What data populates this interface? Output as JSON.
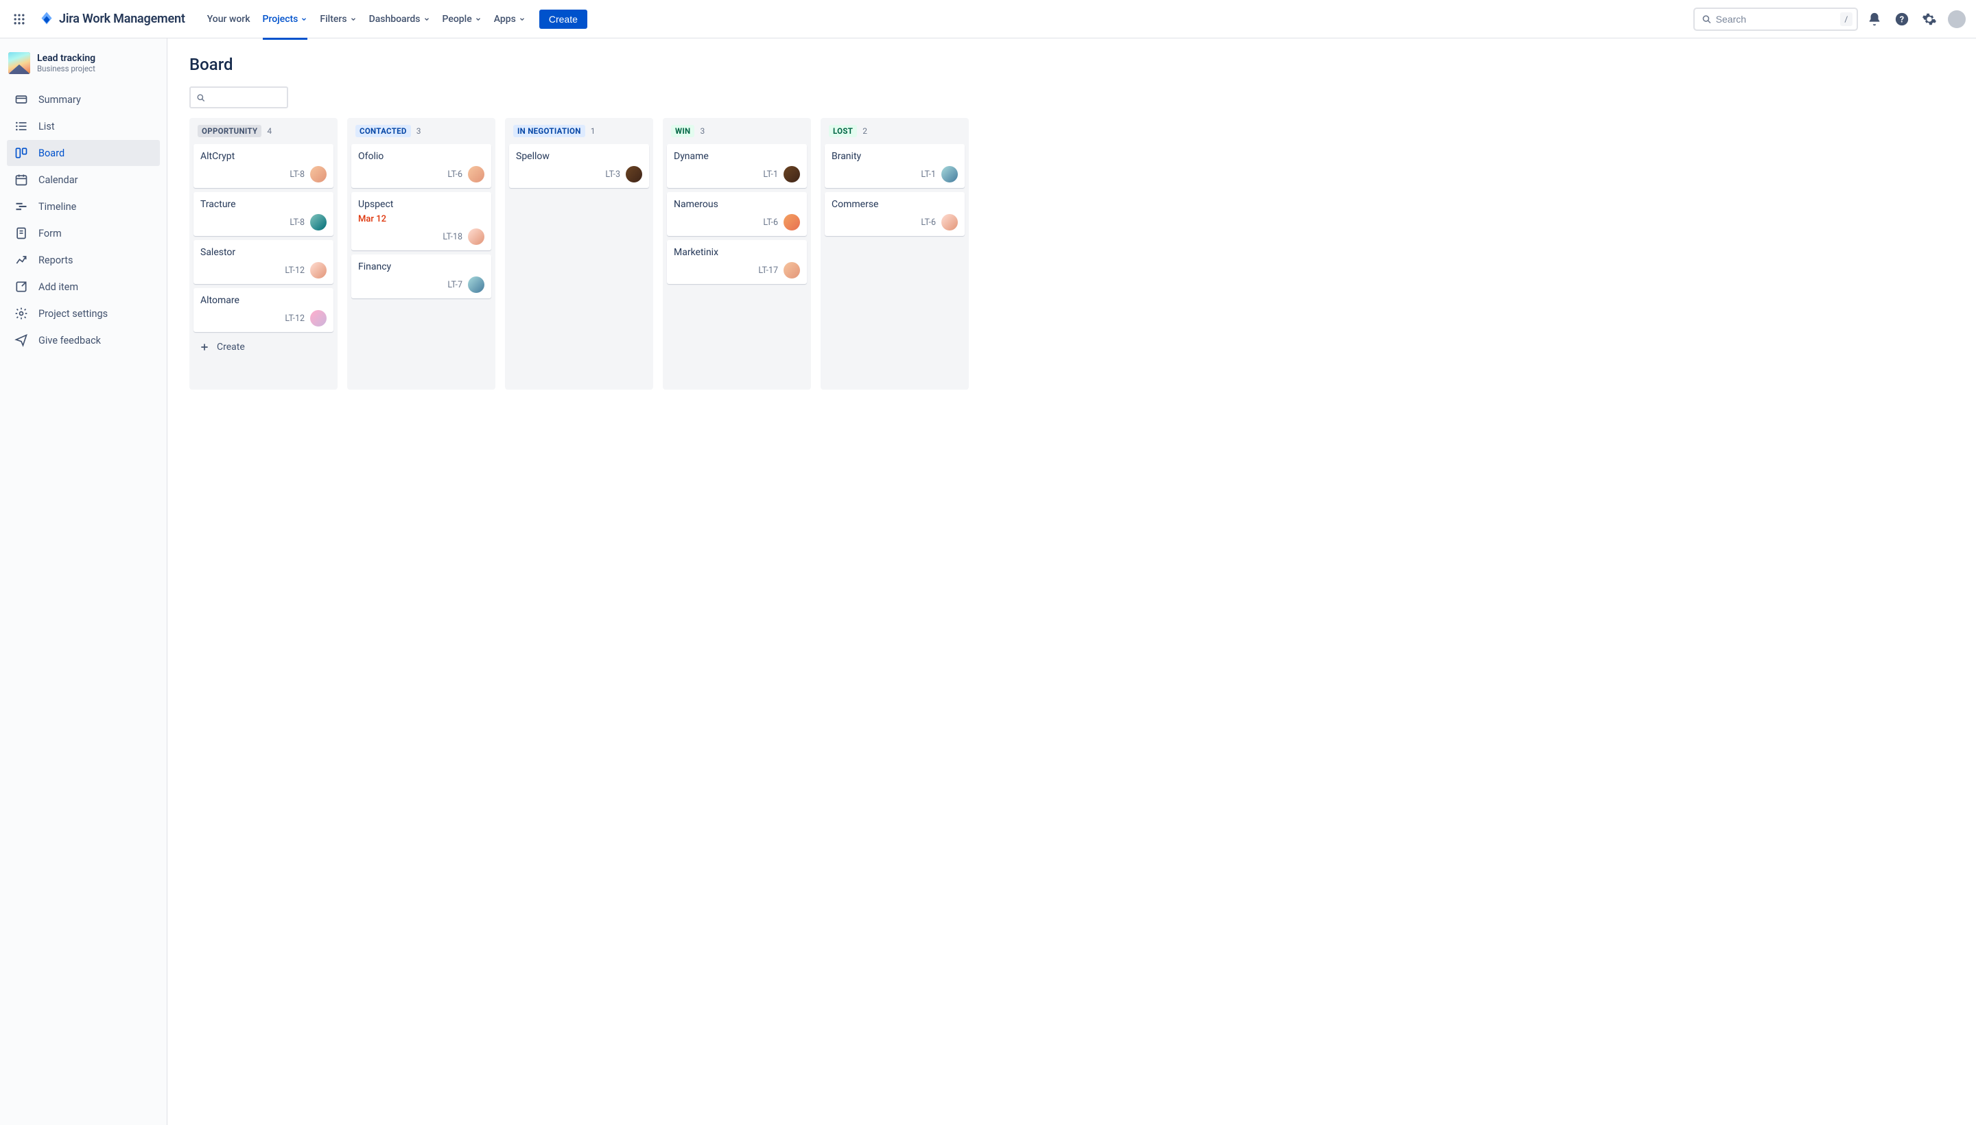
{
  "topnav": {
    "logo_text": "Jira Work Management",
    "items": [
      {
        "label": "Your work",
        "caret": false,
        "active": false
      },
      {
        "label": "Projects",
        "caret": true,
        "active": true
      },
      {
        "label": "Filters",
        "caret": true,
        "active": false
      },
      {
        "label": "Dashboards",
        "caret": true,
        "active": false
      },
      {
        "label": "People",
        "caret": true,
        "active": false
      },
      {
        "label": "Apps",
        "caret": true,
        "active": false
      }
    ],
    "create_label": "Create",
    "search_placeholder": "Search",
    "search_hint": "/"
  },
  "sidebar": {
    "project_name": "Lead tracking",
    "project_subtitle": "Business project",
    "items": [
      {
        "label": "Summary",
        "icon": "card",
        "selected": false
      },
      {
        "label": "List",
        "icon": "list",
        "selected": false
      },
      {
        "label": "Board",
        "icon": "board",
        "selected": true
      },
      {
        "label": "Calendar",
        "icon": "calendar",
        "selected": false
      },
      {
        "label": "Timeline",
        "icon": "timeline",
        "selected": false
      },
      {
        "label": "Form",
        "icon": "form",
        "selected": false
      },
      {
        "label": "Reports",
        "icon": "reports",
        "selected": false
      },
      {
        "label": "Add item",
        "icon": "add",
        "selected": false
      },
      {
        "label": "Project settings",
        "icon": "settings",
        "selected": false
      },
      {
        "label": "Give feedback",
        "icon": "feedback",
        "selected": false
      }
    ]
  },
  "main": {
    "title": "Board",
    "search_placeholder": "",
    "create_card_label": "Create"
  },
  "columns": [
    {
      "name": "OPPORTUNITY",
      "count": 4,
      "title_bg": "#DFE1E6",
      "title_fg": "#42526E",
      "show_create": true,
      "cards": [
        {
          "title": "AltCrypt",
          "key": "LT-8",
          "avatar": "av-1"
        },
        {
          "title": "Tracture",
          "key": "LT-8",
          "avatar": "av-2"
        },
        {
          "title": "Salestor",
          "key": "LT-12",
          "avatar": "av-5"
        },
        {
          "title": "Altomare",
          "key": "LT-12",
          "avatar": "av-8"
        }
      ]
    },
    {
      "name": "CONTACTED",
      "count": 3,
      "title_bg": "#DEEBFF",
      "title_fg": "#0747A6",
      "cards": [
        {
          "title": "Ofolio",
          "key": "LT-6",
          "avatar": "av-1"
        },
        {
          "title": "Upspect",
          "due": "Mar 12",
          "key": "LT-18",
          "avatar": "av-5"
        },
        {
          "title": "Financy",
          "key": "LT-7",
          "avatar": "av-7"
        }
      ]
    },
    {
      "name": "IN NEGOTIATION",
      "count": 1,
      "title_bg": "#DEEBFF",
      "title_fg": "#0747A6",
      "cards": [
        {
          "title": "Spellow",
          "key": "LT-3",
          "avatar": "av-3"
        }
      ]
    },
    {
      "name": "WIN",
      "count": 3,
      "title_bg": "#E3FCEF",
      "title_fg": "#006644",
      "cards": [
        {
          "title": "Dyname",
          "key": "LT-1",
          "avatar": "av-3"
        },
        {
          "title": "Namerous",
          "key": "LT-6",
          "avatar": "av-6"
        },
        {
          "title": "Marketinix",
          "key": "LT-17",
          "avatar": "av-1"
        }
      ]
    },
    {
      "name": "LOST",
      "count": 2,
      "title_bg": "#E3FCEF",
      "title_fg": "#006644",
      "cards": [
        {
          "title": "Branity",
          "key": "LT-1",
          "avatar": "av-7"
        },
        {
          "title": "Commerse",
          "key": "LT-6",
          "avatar": "av-5"
        }
      ]
    }
  ]
}
